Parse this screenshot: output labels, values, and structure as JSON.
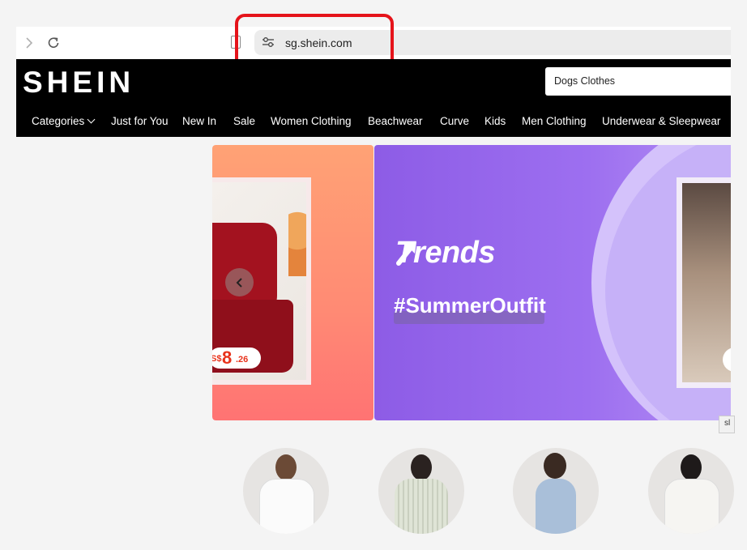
{
  "browser": {
    "url": "sg.shein.com"
  },
  "header": {
    "logo": "SHEIN",
    "search_value": "Dogs Clothes",
    "nav": [
      {
        "label": "Categories",
        "has_dropdown": true
      },
      {
        "label": "Just for You"
      },
      {
        "label": "New In"
      },
      {
        "label": "Sale"
      },
      {
        "label": "Women Clothing"
      },
      {
        "label": "Beachwear"
      },
      {
        "label": "Curve"
      },
      {
        "label": "Kids"
      },
      {
        "label": "Men Clothing"
      },
      {
        "label": "Underwear & Sleepwear"
      }
    ]
  },
  "banner": {
    "left_slide": {
      "price_currency": "S$",
      "price_int": "8",
      "price_dec": ".26"
    },
    "main_slide": {
      "headline": "Trends",
      "hashtag": "#SummerOutfit"
    },
    "tooltip": "sl"
  },
  "colors": {
    "highlight": "#e5131a",
    "header_bg": "#000000",
    "banner_purple": "#9d6ff0",
    "banner_coral": "#ff8a74",
    "price": "#e8321b"
  }
}
